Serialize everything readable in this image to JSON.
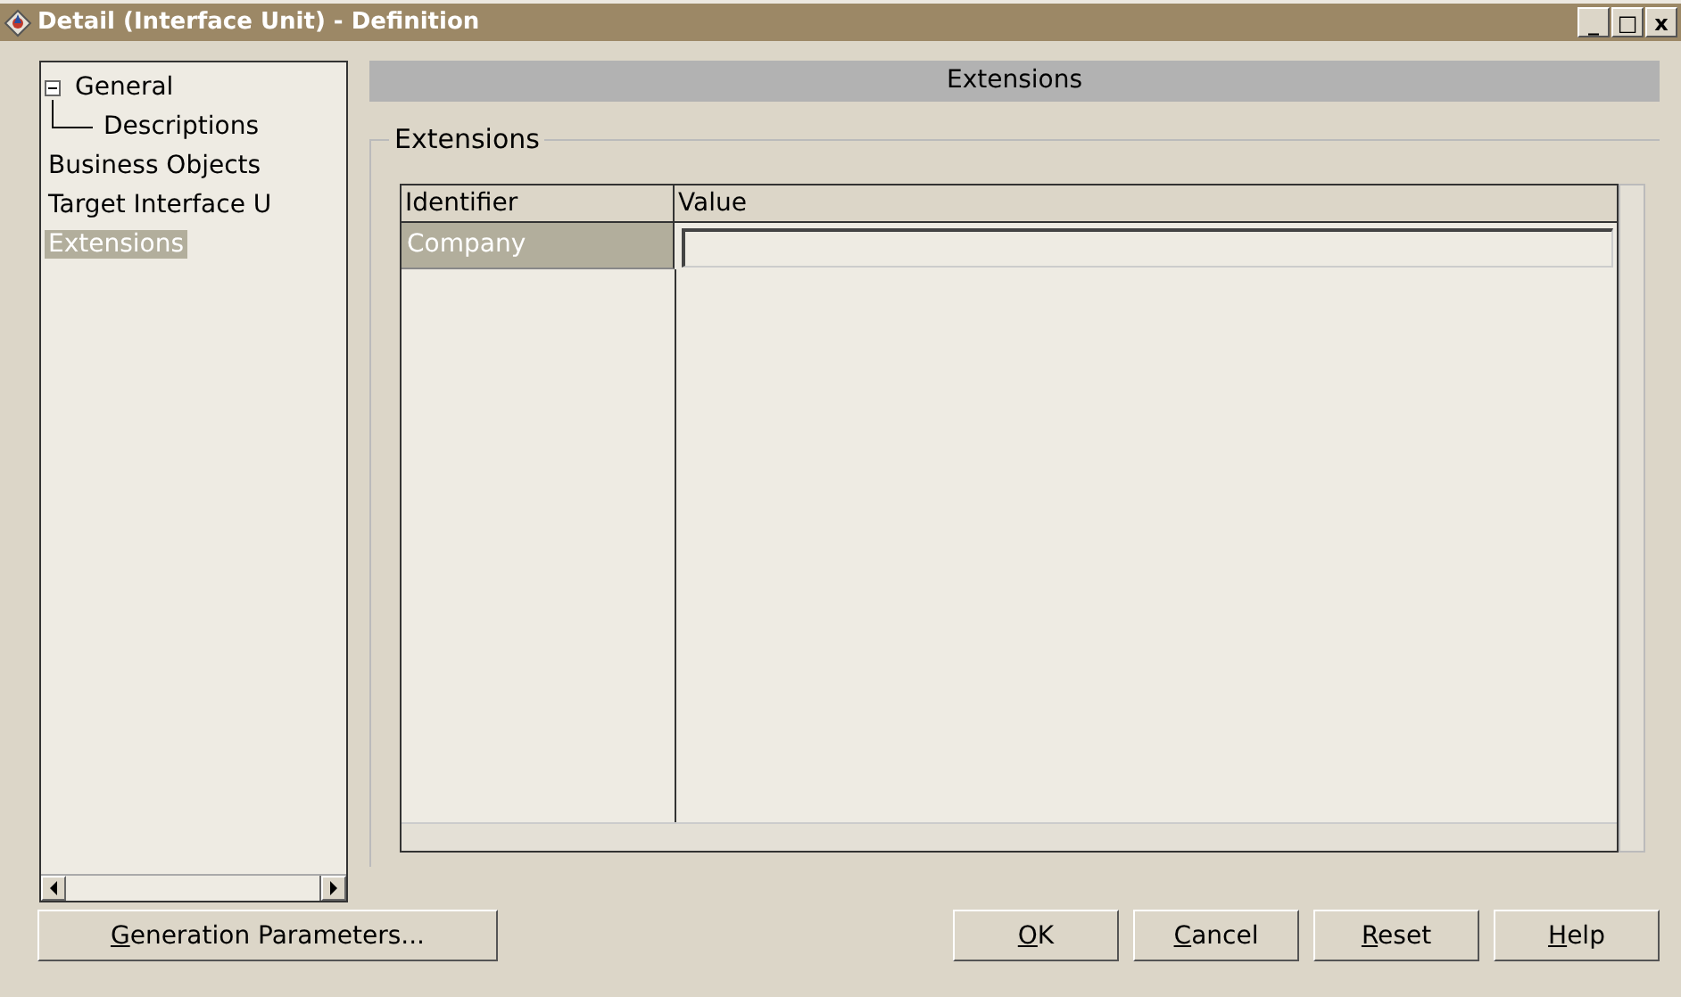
{
  "window": {
    "title": "Detail (Interface Unit) - Definition",
    "controls": [
      "_",
      "□",
      "x"
    ]
  },
  "tree": [
    {
      "label": "General",
      "expanded": true,
      "selected": false,
      "children": [
        {
          "label": "Descriptions",
          "selected": false
        }
      ]
    },
    {
      "label": "Business Objects",
      "selected": false
    },
    {
      "label": "Target Interface U",
      "selected": false
    },
    {
      "label": "Extensions",
      "selected": true
    }
  ],
  "panel": {
    "header": "Extensions",
    "group": "Extensions",
    "table": {
      "columns": [
        "Identifier",
        "Value"
      ],
      "rows": [
        {
          "identifier": "Company",
          "value": "",
          "selected": true
        }
      ]
    }
  },
  "buttons_left": [
    {
      "key": "G",
      "rest": "eneration Parameters..."
    }
  ],
  "buttons_right": [
    {
      "key": "O",
      "rest": "K"
    },
    {
      "key": "C",
      "rest": "ancel"
    },
    {
      "key": "R",
      "rest": "eset"
    },
    {
      "key": "H",
      "rest": "elp"
    }
  ]
}
